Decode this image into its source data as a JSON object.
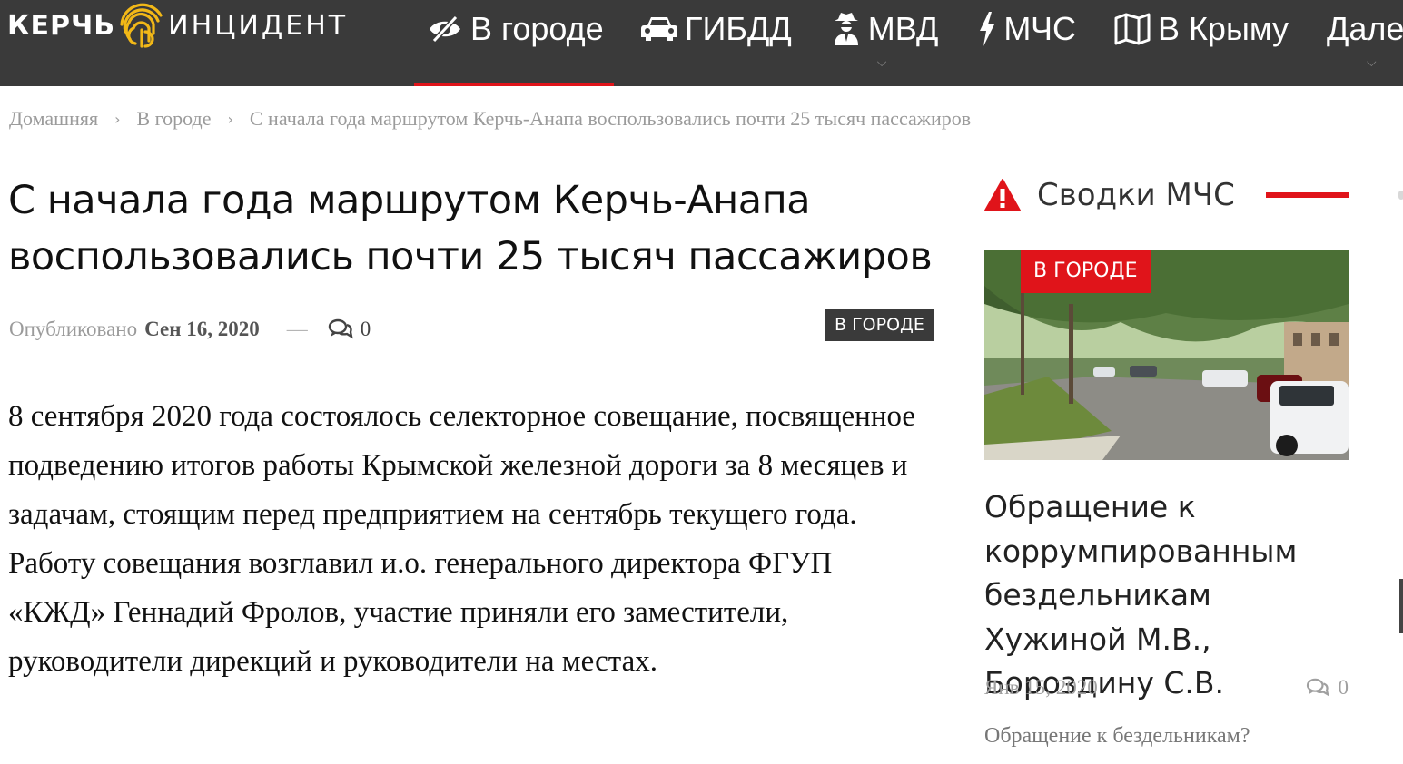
{
  "header": {
    "logo": {
      "word1": "КЕРЧЬ",
      "word2": "ИНЦИДЕНТ"
    },
    "nav": [
      {
        "label": "В городе",
        "icon": "eye-slash-icon",
        "active": true
      },
      {
        "label": "ГИБДД",
        "icon": "car-icon",
        "active": false
      },
      {
        "label": "МВД",
        "icon": "user-secret-icon",
        "active": false,
        "dropdown": true
      },
      {
        "label": "МЧС",
        "icon": "bolt-icon",
        "active": false
      },
      {
        "label": "В Крыму",
        "icon": "map-icon",
        "active": false
      },
      {
        "label": "Далее",
        "icon": "",
        "active": false,
        "dropdown": true
      }
    ]
  },
  "breadcrumb": [
    "Домашняя",
    "В городе",
    "С начала года маршрутом Керчь-Анапа воспользовались почти 25 тысяч пассажиров"
  ],
  "article": {
    "title": "С начала года маршрутом Керчь-Анапа воспользовались почти 25 тысяч пассажиров",
    "published_label": "Опубликовано",
    "date": "Сен 16, 2020",
    "dash": "—",
    "comments": "0",
    "category": "В ГОРОДЕ",
    "body": "8 сентября 2020 года состоялось селекторное совещание, посвященное подведению итогов работы Крымской железной дороги за 8 месяцев и задачам, стоящим перед предприятием на сентябрь текущего года. Работу совещания возглавил и.о. генерального директора ФГУП «КЖД» Геннадий Фролов, участие приняли его заместители, руководители дирекций и руководители на местах."
  },
  "sidebar": {
    "heading": "Сводки МЧС",
    "post": {
      "badge": "В ГОРОДЕ",
      "title": "Обращение к коррумпированным бездельникам Хужиной М.В., Бороздину С.В.",
      "date": "Янв 15, 2020",
      "comments": "0",
      "excerpt": "Обращение к бездельникам?"
    }
  },
  "colors": {
    "accent": "#e0141a",
    "header_bg": "#3a3a3a",
    "badge_dark": "#3a3a3a"
  }
}
